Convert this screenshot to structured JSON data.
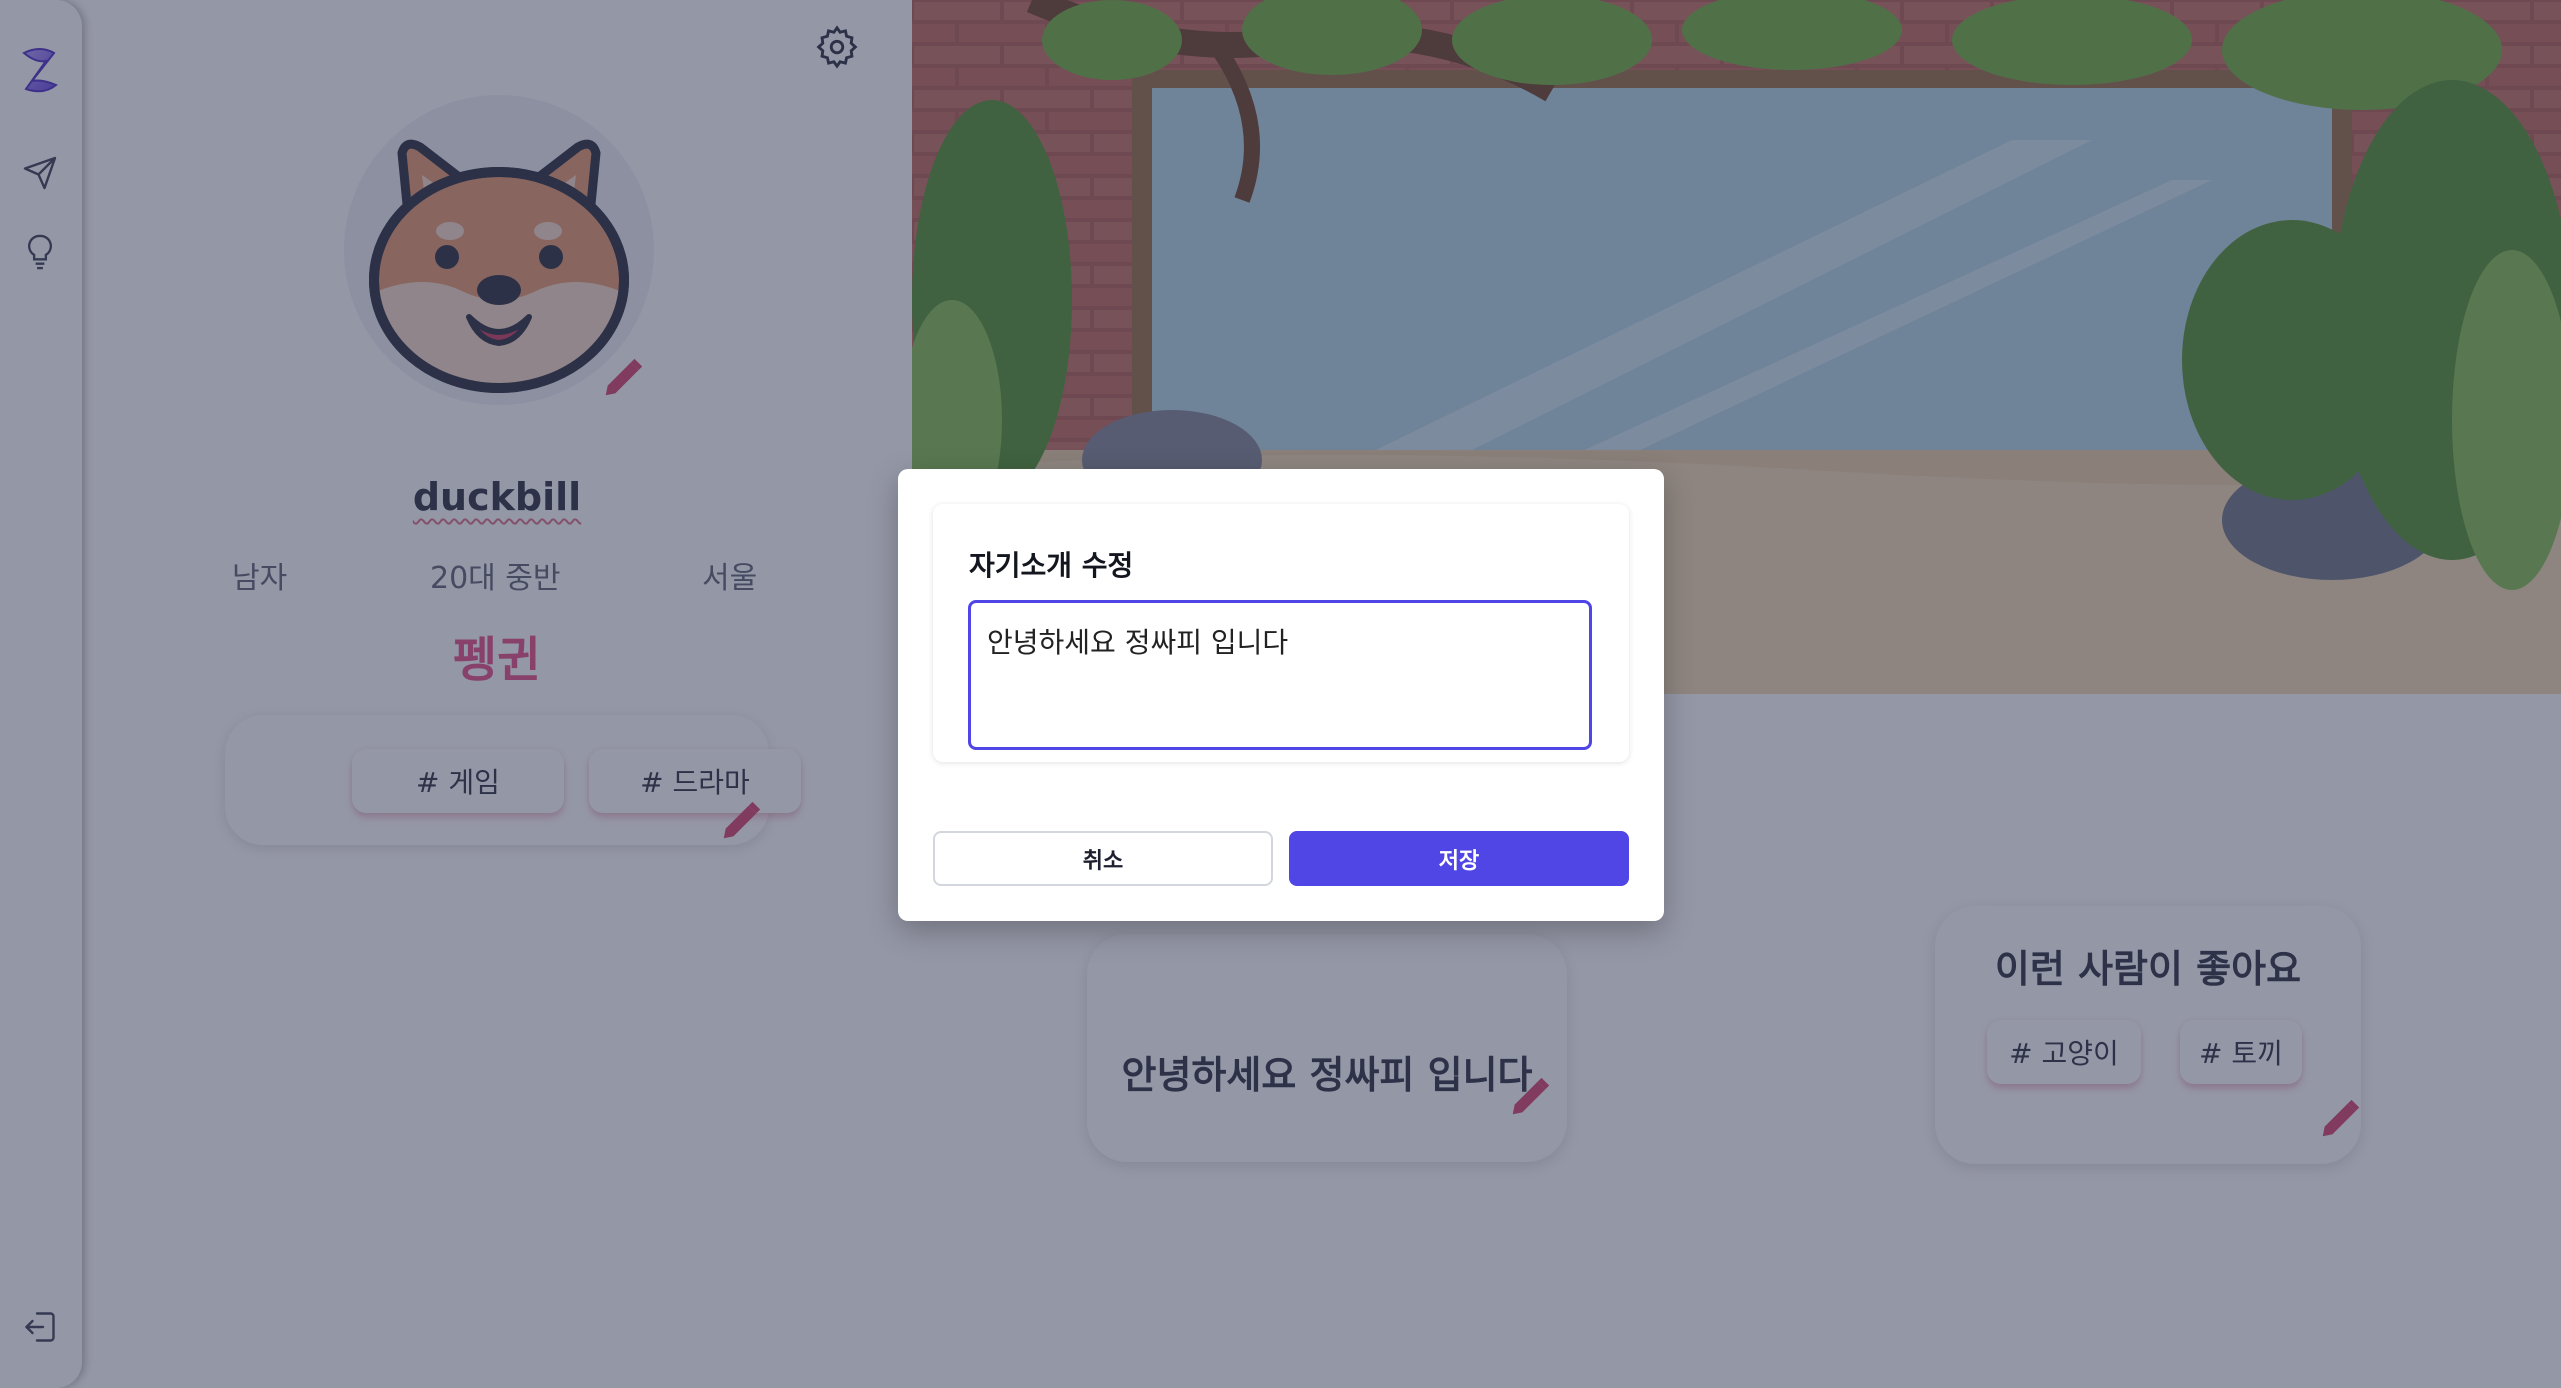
{
  "nav": {
    "logo_glyph": "Z",
    "icons": [
      "send-icon",
      "lightbulb-icon",
      "logout-icon"
    ]
  },
  "profile": {
    "username": "duckbill",
    "gender": "남자",
    "age_group": "20대 중반",
    "location": "서울",
    "animal_type": "펭귄",
    "interests": [
      "# 게임",
      "# 드라마"
    ]
  },
  "intro_card": {
    "text": "안녕하세요 정싸피 입니다"
  },
  "ideal_card": {
    "title": "이런 사람이 좋아요",
    "tags": [
      "# 고양이",
      "# 토끼"
    ]
  },
  "dialog": {
    "title": "자기소개 수정",
    "textarea_value": "안녕하세요 정싸피 입니다",
    "cancel_label": "취소",
    "save_label": "저장"
  },
  "colors": {
    "accent": "#5046e5",
    "animal_text": "#e75a8c",
    "pencil": "#d94f78"
  }
}
